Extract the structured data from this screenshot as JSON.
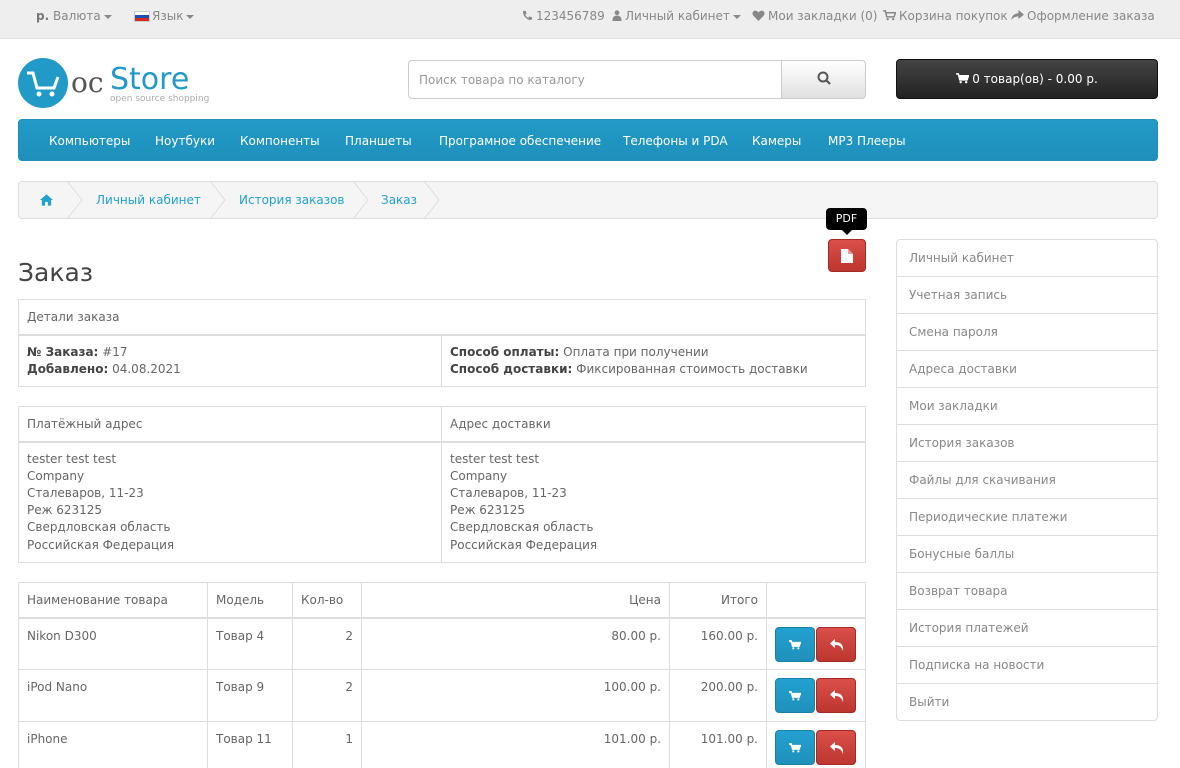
{
  "topbar": {
    "currency_symbol": "р.",
    "currency_label": "Валюта",
    "language_label": "Язык",
    "phone": "123456789",
    "account": "Личный кабинет",
    "wishlist": "Мои закладки (0)",
    "cart": "Корзина покупок",
    "checkout": "Оформление заказа"
  },
  "logo": {
    "oc": "oc",
    "store": "Store",
    "tagline": "open source shopping"
  },
  "search": {
    "placeholder": "Поиск товара по каталогу"
  },
  "cart_button": {
    "label": "0 товар(ов) - 0.00 р."
  },
  "menu": [
    "Компьютеры",
    "Ноутбуки",
    "Компоненты",
    "Планшеты",
    "Програмное обеспечение",
    "Телефоны и PDA",
    "Камеры",
    "MP3 Плееры"
  ],
  "breadcrumb": [
    "Личный кабинет",
    "История заказов",
    "Заказ"
  ],
  "pdf_tooltip": "PDF",
  "page_title": "Заказ",
  "order_details": {
    "header": "Детали заказа",
    "order_no_label": "№ Заказа:",
    "order_no": "#17",
    "added_label": "Добавлено:",
    "added": "04.08.2021",
    "payment_label": "Способ оплаты:",
    "payment": "Оплата при получении",
    "shipping_label": "Способ доставки:",
    "shipping": "Фиксированная стоимость доставки"
  },
  "addresses": {
    "payment_header": "Платёжный адрес",
    "shipping_header": "Адрес доставки",
    "payment_lines": [
      "tester test test",
      "Company",
      "Сталеваров, 11-23",
      "Реж 623125",
      "Свердловская область",
      "Российская Федерация"
    ],
    "shipping_lines": [
      "tester test test",
      "Company",
      "Сталеваров, 11-23",
      "Реж 623125",
      "Свердловская область",
      "Российская Федерация"
    ]
  },
  "products": {
    "headers": [
      "Наименование товара",
      "Модель",
      "Кол-во",
      "Цена",
      "Итого"
    ],
    "rows": [
      {
        "name": "Nikon D300",
        "model": "Товар 4",
        "qty": "2",
        "price": "80.00 р.",
        "total": "160.00 р."
      },
      {
        "name": "iPod Nano",
        "model": "Товар 9",
        "qty": "2",
        "price": "100.00 р.",
        "total": "200.00 р."
      },
      {
        "name": "iPhone",
        "model": "Товар 11",
        "qty": "1",
        "price": "101.00 р.",
        "total": "101.00 р."
      }
    ]
  },
  "sidebar": [
    "Личный кабинет",
    "Учетная запись",
    "Смена пароля",
    "Адреса доставки",
    "Мои закладки",
    "История заказов",
    "Файлы для скачивания",
    "Периодические платежи",
    "Бонусные баллы",
    "Возврат товара",
    "История платежей",
    "Подписка на новости",
    "Выйти"
  ],
  "colors": {
    "menu": "#229ac8",
    "link": "#23a1d1",
    "danger": "#da4f49",
    "cart": "#333333"
  }
}
